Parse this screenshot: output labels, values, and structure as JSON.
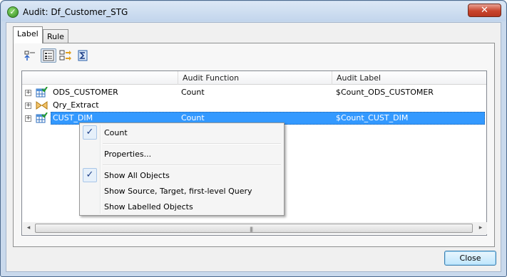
{
  "window": {
    "title": "Audit: Df_Customer_STG",
    "close_glyph": "✕"
  },
  "tabs": [
    {
      "label": "Label",
      "active": true
    },
    {
      "label": "Rule",
      "active": false
    }
  ],
  "toolbar": {
    "icons": [
      "expand-collapse-icon",
      "properties-view-icon",
      "show-source-target-icon",
      "show-labelled-icon"
    ]
  },
  "table": {
    "columns": [
      "",
      "Audit Function",
      "Audit Label"
    ],
    "rows": [
      {
        "name": "ODS_CUSTOMER",
        "function": "Count",
        "label": "$Count_ODS_CUSTOMER",
        "icon": "table-icon",
        "selected": false
      },
      {
        "name": "Qry_Extract",
        "function": "",
        "label": "",
        "icon": "query-icon",
        "selected": false
      },
      {
        "name": "CUST_DIM",
        "function": "Count",
        "label": "$Count_CUST_DIM",
        "icon": "table-icon",
        "selected": true
      }
    ]
  },
  "context_menu": {
    "items": [
      {
        "label": "Count",
        "checked": true
      },
      {
        "label": "Properties...",
        "checked": false
      },
      {
        "label": "Show All Objects",
        "checked": true
      },
      {
        "label": "Show Source, Target, first-level Query",
        "checked": false
      },
      {
        "label": "Show Labelled Objects",
        "checked": false
      }
    ],
    "check_glyph": "✓"
  },
  "scrollbar": {
    "left_arrow": "◂",
    "right_arrow": "▸",
    "grip": "|||"
  },
  "buttons": {
    "close": "Close"
  },
  "colors": {
    "selection": "#3399ff",
    "titlebar": "#c2d5ec",
    "close_button_red": "#c8442c"
  }
}
